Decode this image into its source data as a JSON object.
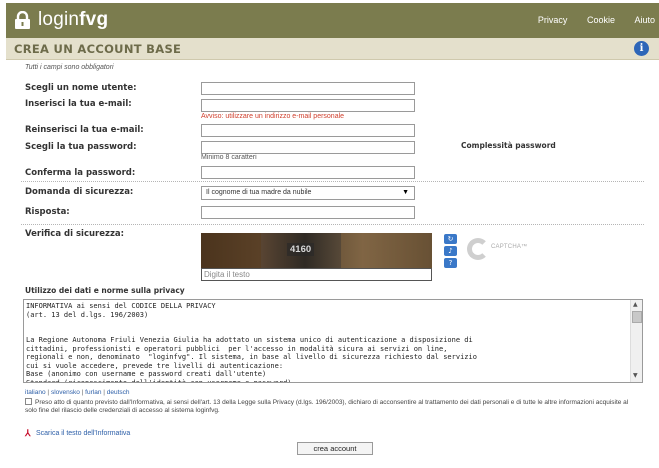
{
  "topbar": {
    "brand_prefix": "login",
    "brand_bold": "fvg",
    "links": [
      "Privacy",
      "Cookie",
      "Aiuto"
    ]
  },
  "titlebar": {
    "title": "CREA UN ACCOUNT BASE",
    "info_symbol": "i"
  },
  "form": {
    "note": "Tutti i campi sono obbligatori",
    "username_label": "Scegli un nome utente:",
    "email_label": "Inserisci la tua e-mail:",
    "email_warning": "Avviso: utilizzare un indirizzo e-mail personale",
    "email_confirm_label": "Reinserisci la tua e-mail:",
    "password_label": "Scegli la tua password:",
    "password_hint": "Minimo 8 caratteri",
    "password_complexity": "Complessità password",
    "password_confirm_label": "Conferma la password:",
    "security_question_label": "Domanda di sicurezza:",
    "security_question_value": "Il cognome di tua madre da nubile",
    "answer_label": "Risposta:",
    "captcha_label": "Verifica di sicurezza:",
    "captcha_number": "4160",
    "captcha_placeholder": "Digita il testo",
    "recaptcha_text": "CAPTCHA™"
  },
  "privacy": {
    "heading": "Utilizzo dei dati e norme sulla privacy",
    "text": "INFORMATIVA ai sensi del CODICE DELLA PRIVACY\n(art. 13 del d.lgs. 196/2003)\n\n\nLa Regione Autonoma Friuli Venezia Giulia ha adottato un sistema unico di autenticazione a disposizione di\ncittadini, professionisti e operatori pubblici  per l'accesso in modalità sicura ai servizi on line,\nregionali e non, denominato  \"loginfvg\". Il sistema, in base al livello di sicurezza richiesto dal servizio\ncui si vuole accedere, prevede tre livelli di autenticazione:\nBase (anonimo con username e password creati dall'utente)\nStandard (riconoscimento dell'identità con username e password)",
    "languages": [
      "italiano",
      "slovensko",
      "furlan",
      "deutsch"
    ],
    "consent": "Preso atto di quanto previsto dall'Informativa, ai sensi dell'art. 13 della Legge sulla Privacy (d.lgs. 196/2003), dichiaro di acconsentire al trattamento dei dati personali e di tutte le altre informazioni acquisite al solo fine del rilascio delle credenziali di accesso al sistema loginfvg.",
    "download": "Scarica il testo dell'Informativa"
  },
  "submit_label": "crea account",
  "colors": {
    "topbar": "#7b7c4e",
    "titlebar": "#e4e0cc",
    "warning": "#d0402e",
    "link": "#2d5fa8"
  }
}
